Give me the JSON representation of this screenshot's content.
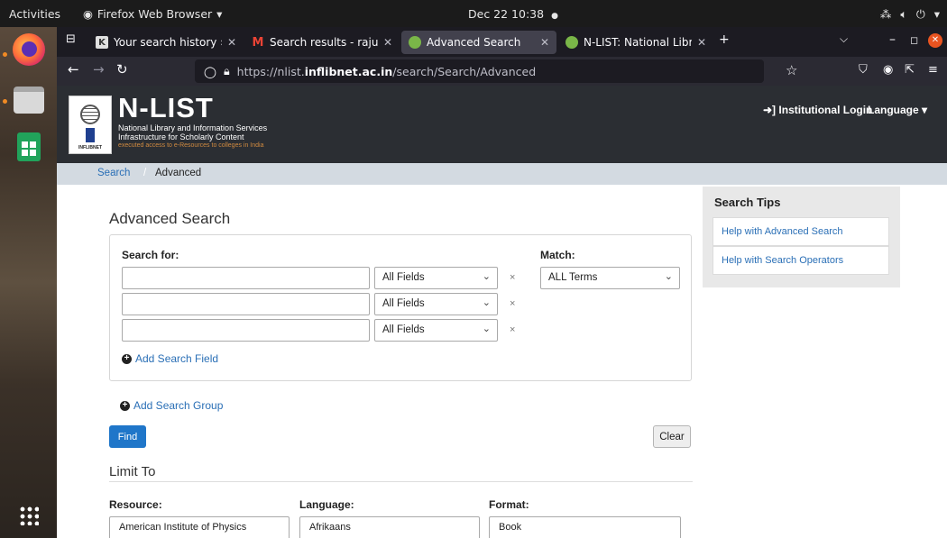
{
  "topbar": {
    "activities": "Activities",
    "app_menu": "Firefox Web Browser",
    "clock": "Dec 22  10:38",
    "recording_dot": "●"
  },
  "browser": {
    "tabs": [
      {
        "title": "Your search history › Koh",
        "favicon": "koha-icon",
        "favicon_color": "#e95420",
        "active": false
      },
      {
        "title": "Search results - rajumere",
        "favicon": "gmail-icon",
        "favicon_color": "#ea4335",
        "active": false
      },
      {
        "title": "Advanced Search",
        "favicon": "nlist-icon",
        "favicon_color": "#7ab648",
        "active": true
      },
      {
        "title": "N-LIST: National Library a",
        "favicon": "nlist-icon",
        "favicon_color": "#7ab648",
        "active": false
      }
    ],
    "url": {
      "prefix": "https://nlist.",
      "domain": "inflibnet.ac.in",
      "path": "/search/Search/Advanced"
    }
  },
  "site": {
    "brand": {
      "name": "N-LIST",
      "line1": "National Library and Information Services",
      "line2": "Infrastructure for Scholarly Content",
      "line3": "executed access to e-Resources to colleges in India",
      "logo_word": "INFLIBNET"
    },
    "header_links": {
      "login": "Institutional Login",
      "language": "Language"
    },
    "breadcrumb": {
      "link": "Search",
      "separator": "/",
      "current": "Advanced"
    }
  },
  "advanced_search": {
    "title": "Advanced Search",
    "search_for_label": "Search for:",
    "match_label": "Match:",
    "match_value": "ALL Terms",
    "rows": [
      {
        "value": "",
        "field": "All Fields"
      },
      {
        "value": "",
        "field": "All Fields"
      },
      {
        "value": "",
        "field": "All Fields"
      }
    ],
    "remove_symbol": "×",
    "add_field": "Add Search Field",
    "add_group": "Add Search Group",
    "find_label": "Find",
    "clear_label": "Clear"
  },
  "limit": {
    "title": "Limit To",
    "resource_label": "Resource:",
    "language_label": "Language:",
    "format_label": "Format:",
    "resource_first": "American Institute of Physics",
    "language_first": "Afrikaans",
    "format_first": "Book"
  },
  "tips": {
    "title": "Search Tips",
    "link1": "Help with Advanced Search",
    "link2": "Help with Search Operators"
  },
  "colors": {
    "header_bg": "#2b2e33",
    "breadcrumb_bg": "#d3dae1",
    "link": "#2a6fb6",
    "primary_button": "#1f76c9",
    "tabstrip_bg": "#1c1b22",
    "navbar_bg": "#2b2a33"
  }
}
